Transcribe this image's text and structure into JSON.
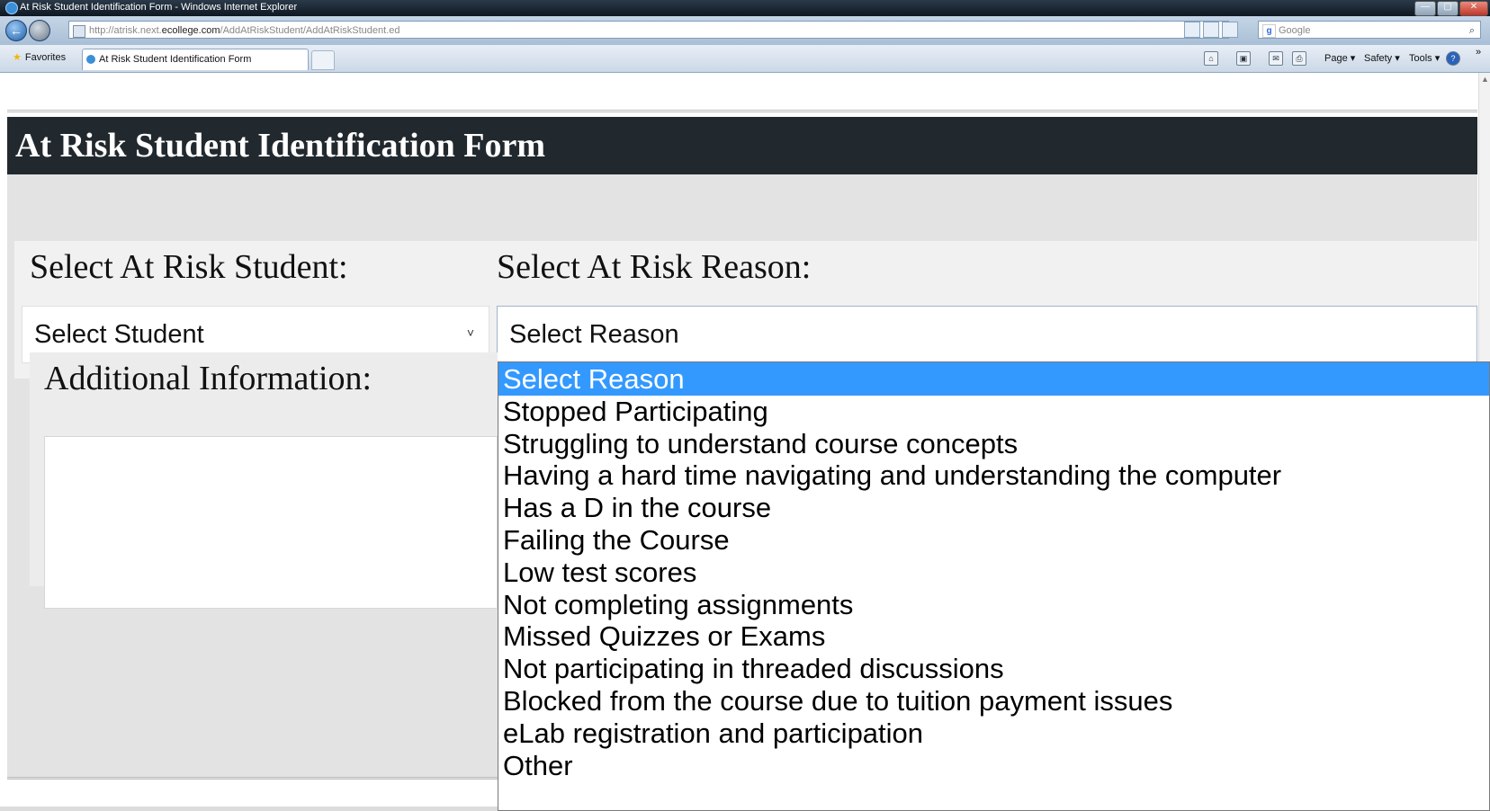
{
  "window": {
    "title": "At Risk Student Identification Form - Windows Internet Explorer",
    "min_glyph": "—",
    "max_glyph": "▢",
    "close_glyph": "✕"
  },
  "nav": {
    "back_glyph": "←",
    "address_prefix": "http://atrisk.next.",
    "address_domain": "ecollege.com",
    "address_suffix": "/AddAtRiskStudent/AddAtRiskStudent.ed",
    "search_placeholder": "Google",
    "google_glyph": "g",
    "search_glyph": "⌕"
  },
  "tabs": {
    "favorites_label": "Favorites",
    "active_tab_label": "At Risk Student Identification Form"
  },
  "command_bar": {
    "home_glyph": "⌂",
    "feed_glyph": "▣",
    "mail_glyph": "✉",
    "print_glyph": "⎙",
    "page_label": "Page ▾",
    "safety_label": "Safety ▾",
    "tools_label": "Tools ▾",
    "help_glyph": "?",
    "overflow_glyph": "»"
  },
  "page": {
    "header_title": "At Risk Student Identification Form",
    "student_label": "Select At Risk Student:",
    "reason_label": "Select At Risk Reason:",
    "student_select_value": "Select Student",
    "student_select_arrow": "˅",
    "reason_select_value": "Select Reason",
    "additional_label": "Additional Information:",
    "additional_value": ""
  },
  "dropdown": {
    "selected_index": 0,
    "options": [
      "Select Reason",
      "Stopped Participating",
      "Struggling to understand course concepts",
      "Having a hard time navigating and understanding the computer",
      "Has a D in the course",
      "Failing the Course",
      "Low test scores",
      "Not completing assignments",
      "Missed Quizzes or Exams",
      "Not participating in threaded discussions",
      "Blocked from the course due to tuition payment issues",
      "eLab registration and participation",
      "Other"
    ]
  },
  "colors": {
    "header_bg": "#22292e",
    "selected_option_bg": "#3399ff",
    "form_bg": "#e3e3e3"
  }
}
